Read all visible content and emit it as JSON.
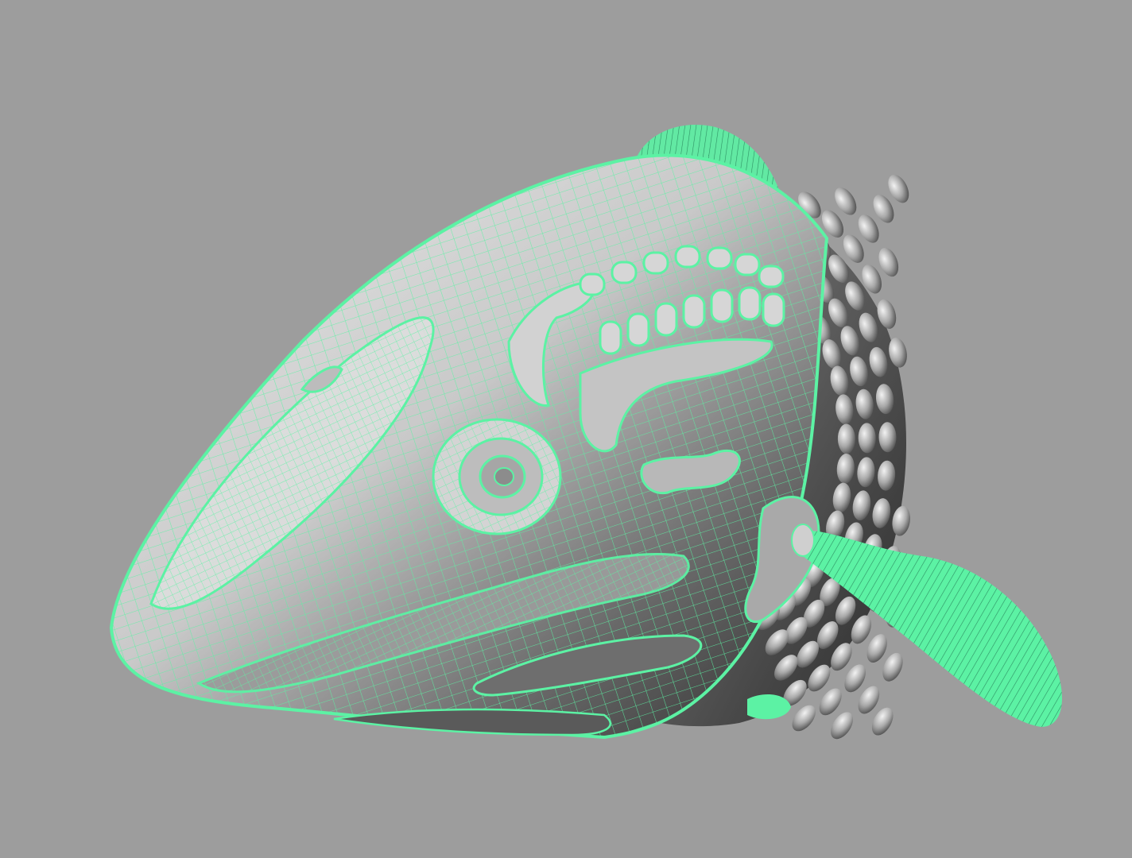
{
  "viewport": {
    "background_color": "#9d9d9d",
    "wireframe_color": "#5cf2a4",
    "shade_light": "#e2e2e2",
    "shade_dark": "#3a3a3a",
    "selected_object": "fish-head-model"
  }
}
